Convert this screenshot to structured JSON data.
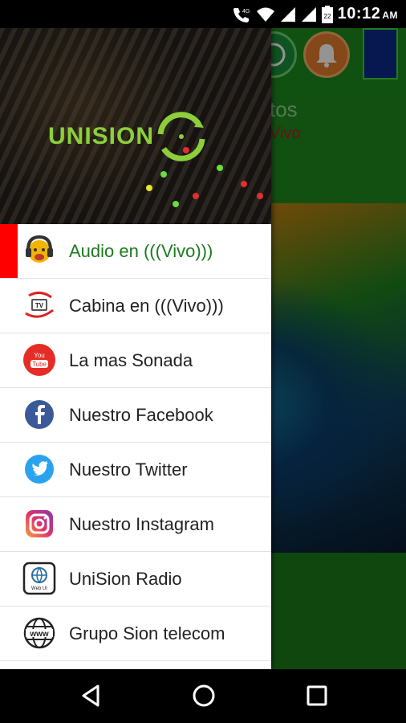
{
  "status_bar": {
    "network_type": "4G",
    "sim_badge": "22",
    "time": "10:12",
    "ampm": "AM"
  },
  "background_app": {
    "title_fragment": "tos",
    "subtitle_fragment": "Vivo"
  },
  "drawer": {
    "logo_text": "UNISION",
    "items": [
      {
        "label": "Audio en (((Vivo)))",
        "icon": "radio-host-icon",
        "active": true
      },
      {
        "label": "Cabina en (((Vivo)))",
        "icon": "tv-icon",
        "active": false
      },
      {
        "label": "La mas Sonada",
        "icon": "youtube-icon",
        "active": false
      },
      {
        "label": "Nuestro Facebook",
        "icon": "facebook-icon",
        "active": false
      },
      {
        "label": "Nuestro Twitter",
        "icon": "twitter-icon",
        "active": false
      },
      {
        "label": "Nuestro Instagram",
        "icon": "instagram-icon",
        "active": false
      },
      {
        "label": "UniSion Radio",
        "icon": "web-icon",
        "active": false
      },
      {
        "label": "Grupo Sion telecom",
        "icon": "www-globe-icon",
        "active": false
      }
    ],
    "web_icon_caption": "Web UI"
  },
  "colors": {
    "active_indicator": "#ff0000",
    "active_label": "#1d7a1d",
    "brand_green": "#8ccf3a"
  }
}
